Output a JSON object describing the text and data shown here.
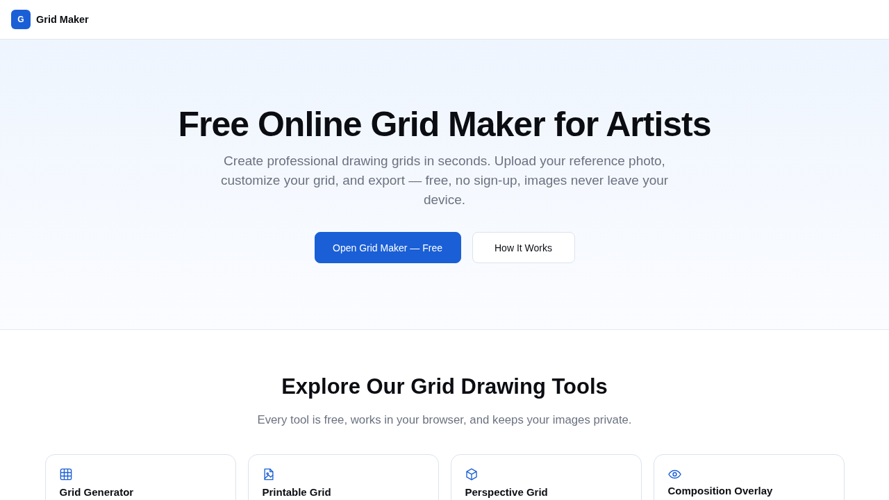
{
  "header": {
    "logo_letter": "G",
    "brand": "Grid Maker"
  },
  "hero": {
    "title": "Free Online Grid Maker for Artists",
    "subtitle": "Create professional drawing grids in seconds. Upload your reference photo, customize your grid, and export — free, no sign-up, images never leave your device.",
    "buttons": [
      {
        "label": "Open Grid Maker — Free",
        "kind": "primary"
      },
      {
        "label": "How It Works",
        "kind": "secondary"
      }
    ]
  },
  "tools": {
    "title": "Explore Our Grid Drawing Tools",
    "subtitle": "Every tool is free, works in your browser, and keeps your images private.",
    "cards": [
      {
        "title": "Grid Generator"
      },
      {
        "title": "Printable Grid"
      },
      {
        "title": "Perspective Grid"
      },
      {
        "title": "Composition Overlay"
      }
    ]
  }
}
